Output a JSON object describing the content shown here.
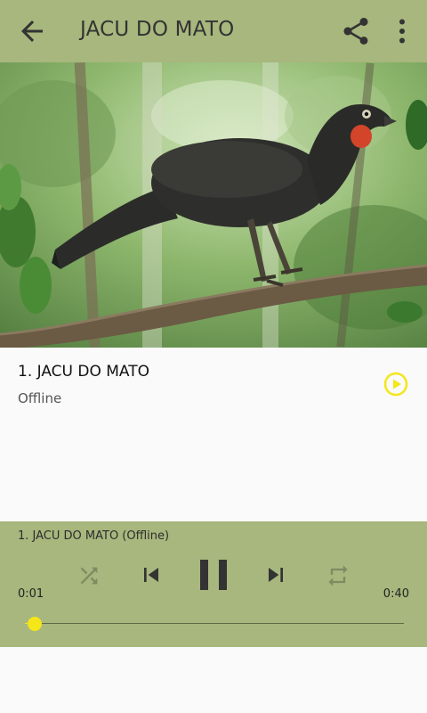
{
  "appbar": {
    "title": "JACU DO MATO",
    "icons": {
      "back": "arrow-back-icon",
      "share": "share-icon",
      "more": "more-vert-icon"
    }
  },
  "photo": {
    "subject": "bird-photo"
  },
  "track": {
    "name": "1. JACU DO MATO",
    "status": "Offline",
    "play_icon": "play-circle-icon"
  },
  "player": {
    "now_playing": "1. JACU DO MATO (Offline)",
    "elapsed": "0:01",
    "duration": "0:40",
    "progress": 0.025,
    "controls": [
      "shuffle-icon",
      "skip-previous-icon",
      "pause-icon",
      "skip-next-icon",
      "repeat-icon"
    ]
  },
  "colors": {
    "bar": "#a7b77d",
    "accent": "#f5e61a",
    "dark_icon": "#333333",
    "disabled_icon": "#7f8a62"
  }
}
